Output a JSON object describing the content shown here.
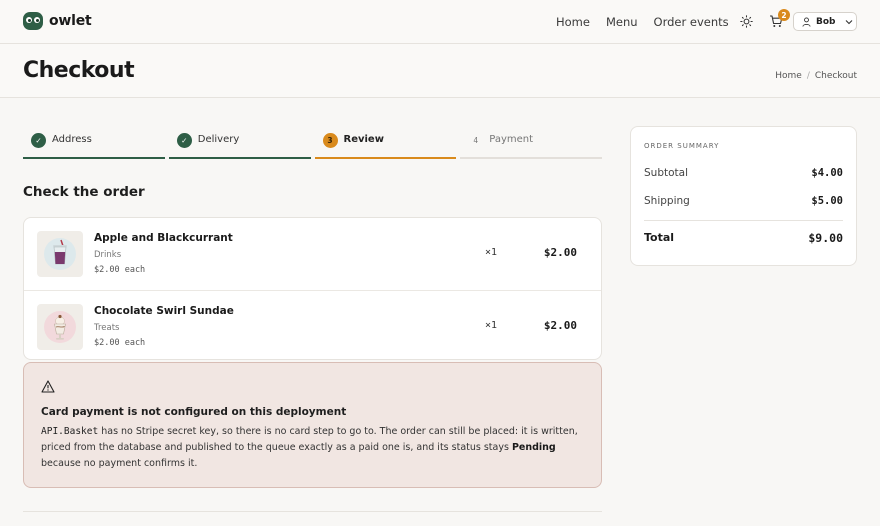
{
  "brand": {
    "name": "owlet",
    "color": "#2e5e46"
  },
  "nav": {
    "links": [
      "Home",
      "Menu",
      "Order events"
    ],
    "theme_icon": "sun-icon",
    "cart_count": "2",
    "user": "Bob"
  },
  "page": {
    "title": "Checkout",
    "breadcrumb": [
      "Home",
      "Checkout"
    ]
  },
  "steps": [
    {
      "label": "Address",
      "marker": "✓",
      "state": "done"
    },
    {
      "label": "Delivery",
      "marker": "✓",
      "state": "done"
    },
    {
      "label": "Review",
      "marker": "3",
      "state": "active"
    },
    {
      "label": "Payment",
      "marker": "4",
      "state": "pending"
    }
  ],
  "accent": "#d98a1c",
  "section_title": "Check the order",
  "items": [
    {
      "name": "Apple and Blackcurrant",
      "category": "Drinks",
      "each": "$2.00 each",
      "qty": "×1",
      "price": "$2.00"
    },
    {
      "name": "Chocolate Swirl Sundae",
      "category": "Treats",
      "each": "$2.00 each",
      "qty": "×1",
      "price": "$2.00"
    }
  ],
  "warning": {
    "title": "Card payment is not configured on this deployment",
    "code": "API.Basket",
    "text_1": " has no Stripe secret key, so there is no card step to go to. The order can still be placed: it is written, priced from the database and published to the queue exactly as a paid one is, and its status stays ",
    "status": "Pending",
    "text_2": " because no payment confirms it."
  },
  "summary": {
    "title": "ORDER SUMMARY",
    "subtotal_label": "Subtotal",
    "subtotal": "$4.00",
    "shipping_label": "Shipping",
    "shipping": "$5.00",
    "total_label": "Total",
    "total": "$9.00"
  }
}
